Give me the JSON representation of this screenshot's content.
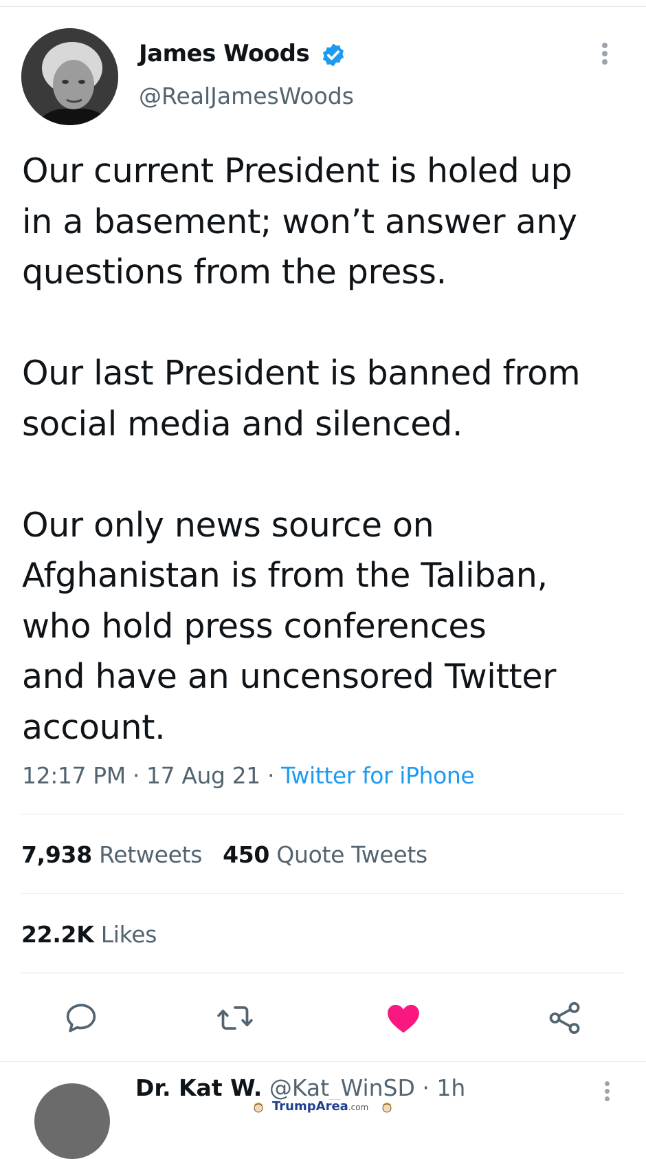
{
  "tweet": {
    "author": {
      "name": "James Woods",
      "handle": "@RealJamesWoods",
      "verified_icon": "verified-badge-icon"
    },
    "text": "Our current President is holed up\nin a basement; won’t answer any\nquestions from the press.\n\nOur last President is banned from\nsocial media and silenced.\n\nOur only news source on\nAfghanistan is from the Taliban,\nwho hold press conferences\nand have an uncensored Twitter\naccount.",
    "time": "12:17 PM",
    "sep1": "·",
    "date": "17 Aug 21",
    "sep2": "·",
    "source": "Twitter for iPhone",
    "stats": {
      "retweets_count": "7,938",
      "retweets_label": "Retweets",
      "quotes_count": "450",
      "quotes_label": "Quote Tweets",
      "likes_count": "22.2K",
      "likes_label": "Likes"
    },
    "actions": {
      "reply_icon": "comment-icon",
      "retweet_icon": "retweet-icon",
      "like_icon": "heart-icon",
      "share_icon": "share-icon",
      "liked": true
    }
  },
  "next_reply": {
    "name": "Dr. Kat W.",
    "handle": "@Kat_WinSD",
    "sep": "·",
    "age": "1h"
  },
  "watermark": {
    "brand": "TrumpArea",
    "suffix": ".com"
  },
  "colors": {
    "accent": "#1d9bf0",
    "like": "#f91880",
    "text": "#0f1419",
    "muted": "#536471"
  }
}
